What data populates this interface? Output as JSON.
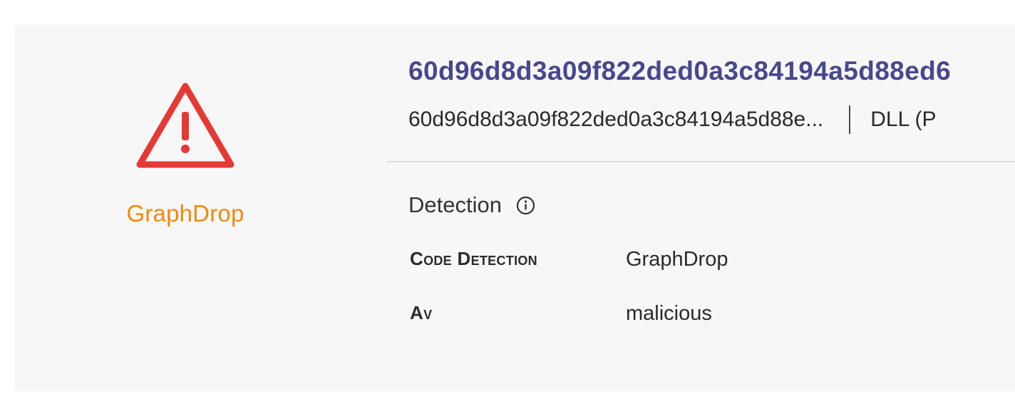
{
  "summary": {
    "family_name": "GraphDrop",
    "status_icon": "warning-triangle-icon",
    "status_color": "#e53935",
    "family_color": "#f08a0c",
    "hash_title": "60d96d8d3a09f822ded0a3c84194a5d88ed6",
    "hash_truncated": "60d96d8d3a09f822ded0a3c84194a5d88e...",
    "file_type": "DLL (P",
    "title_color": "#49478f"
  },
  "detection": {
    "title": "Detection",
    "info_icon": "info-icon",
    "rows": [
      {
        "label": "Code Detection",
        "value": "GraphDrop"
      },
      {
        "label": "Av",
        "value": "malicious"
      }
    ]
  }
}
